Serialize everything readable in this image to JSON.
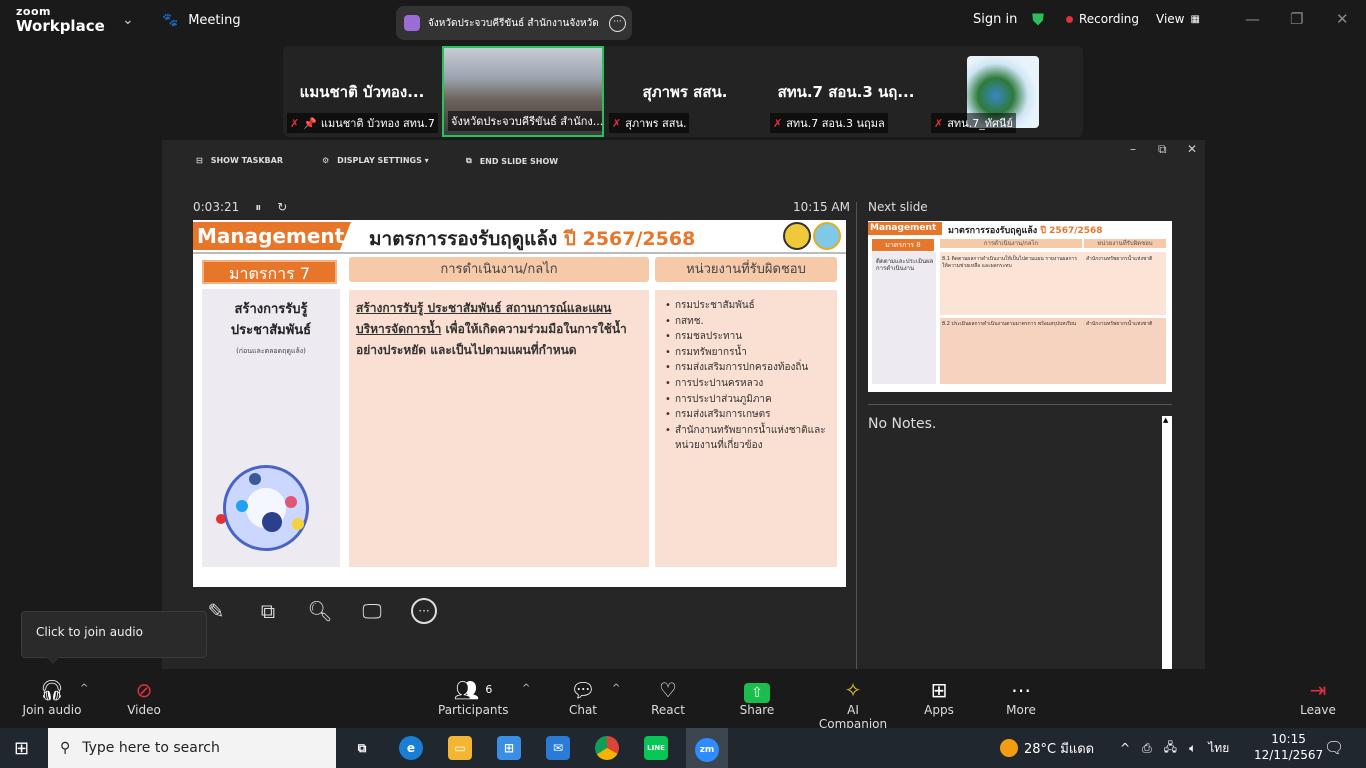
{
  "app": {
    "logo_top": "zoom",
    "logo_bottom": "Workplace",
    "meeting_label": "Meeting"
  },
  "title_bar": {
    "meeting_title": "จังหวัดประจวบคีรีขันธ์ สำนักงานจังหวัด"
  },
  "top_right": {
    "sign_in": "Sign in",
    "recording": "Recording",
    "view": "View"
  },
  "participants_strip": [
    {
      "display_name": "แมนชาติ บัวทอง...",
      "label": "แมนชาติ บัวทอง สทน.7"
    },
    {
      "display_name": "",
      "label": "จังหวัดประจวบคีรีขันธ์ สำนักง..."
    },
    {
      "display_name": "สุภาพร สสน.",
      "label": "สุภาพร สสน."
    },
    {
      "display_name": "สทน.7 สอน.3 นฤ...",
      "label": "สทน.7 สอน.3 นฤมล"
    },
    {
      "display_name": "",
      "label": "สทน.7_ทัศนีย์"
    }
  ],
  "slideshow": {
    "tools": {
      "show_taskbar": "SHOW TASKBAR",
      "display_settings": "DISPLAY SETTINGS ▾",
      "end_slide_show": "END SLIDE SHOW"
    },
    "elapsed": "0:03:21",
    "clock": "10:15 AM",
    "next_slide_label": "Next slide",
    "notes": "No Notes."
  },
  "slide": {
    "badge": "Management",
    "title": "มาตรการรองรับฤดูแล้ง",
    "year": "ปี 2567/2568",
    "measure_header": "มาตรการ 7",
    "measure_title": "สร้างการรับรู้ ประชาสัมพันธ์",
    "measure_sub": "(ก่อนและตลอดฤดูแล้ง)",
    "col2_header": "การดำเนินงาน/กลไก",
    "col2_underlined": "สร้างการรับรู้ ประชาสัมพันธ์ สถานการณ์และแผนบริหารจัดการน้ำ",
    "col2_rest": " เพื่อให้เกิดความร่วมมือในการใช้น้ำอย่างประหยัด และเป็นไปตามแผนที่กำหนด",
    "col3_header": "หน่วยงานที่รับผิดชอบ",
    "agencies": [
      "กรมประชาสัมพันธ์",
      "กสทช.",
      "กรมชลประทาน",
      "กรมทรัพยากรน้ำ",
      "กรมส่งเสริมการปกครองท้องถิ่น",
      "การประปานครหลวง",
      "การประปาส่วนภูมิภาค",
      "กรมส่งเสริมการเกษตร",
      "สำนักงานทรัพยากรน้ำแห่งชาติและหน่วยงานที่เกี่ยวข้อง"
    ]
  },
  "next_slide": {
    "badge": "Management",
    "title": "มาตรการรองรับฤดูแล้ง",
    "year": "ปี 2567/2568",
    "measure": "มาตรการ 8",
    "col2_header": "การดำเนินงาน/กลไก",
    "col3_header": "หน่วยงานที่รับผิดชอบ",
    "left_text": "ติดตามและประเมินผลการดำเนินงาน",
    "row1": "8.1 ติดตามผลการดำเนินงานให้เป็นไปตามแผน รายงานผลการให้ความช่วยเหลือ และผลกระทบ",
    "row2": "8.2 ประเมินผลการดำเนินงานตามมาตรการ พร้อมสรุปบทเรียน",
    "row1_agencies": "สำนักงานทรัพยากรน้ำแห่งชาติ",
    "row2_agencies": "สำนักงานทรัพยากรน้ำแห่งชาติ"
  },
  "tooltip": {
    "text": "Click to join audio"
  },
  "toolbar": {
    "join_audio": "Join audio",
    "video": "Video",
    "participants": "Participants",
    "participants_count": "6",
    "chat": "Chat",
    "react": "React",
    "share": "Share",
    "ai_companion": "AI Companion",
    "apps": "Apps",
    "more": "More",
    "leave": "Leave"
  },
  "taskbar": {
    "search_placeholder": "Type here to search",
    "weather": "28°C มีแดด",
    "lang": "ไทย",
    "time": "10:15",
    "date": "12/11/2567"
  }
}
